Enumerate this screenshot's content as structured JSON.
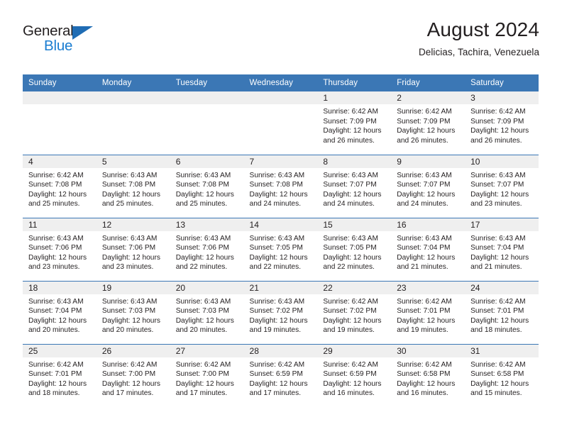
{
  "brand": {
    "name_part1": "General",
    "name_part2": "Blue",
    "triangle_color": "#1f6cb4",
    "blue_color": "#1a7dd1"
  },
  "header": {
    "month_title": "August 2024",
    "location": "Delicias, Tachira, Venezuela"
  },
  "theme": {
    "header_blue": "#3b77b5",
    "daynum_band": "#efefef",
    "text": "#231f20"
  },
  "weekday_headers": [
    "Sunday",
    "Monday",
    "Tuesday",
    "Wednesday",
    "Thursday",
    "Friday",
    "Saturday"
  ],
  "labels": {
    "sunrise_prefix": "Sunrise: ",
    "sunset_prefix": "Sunset: ",
    "daylight_prefix": "Daylight: "
  },
  "weeks": [
    [
      {
        "day": "",
        "empty": true
      },
      {
        "day": "",
        "empty": true
      },
      {
        "day": "",
        "empty": true
      },
      {
        "day": "",
        "empty": true
      },
      {
        "day": "1",
        "sunrise": "Sunrise: 6:42 AM",
        "sunset": "Sunset: 7:09 PM",
        "daylight": "Daylight: 12 hours and 26 minutes."
      },
      {
        "day": "2",
        "sunrise": "Sunrise: 6:42 AM",
        "sunset": "Sunset: 7:09 PM",
        "daylight": "Daylight: 12 hours and 26 minutes."
      },
      {
        "day": "3",
        "sunrise": "Sunrise: 6:42 AM",
        "sunset": "Sunset: 7:09 PM",
        "daylight": "Daylight: 12 hours and 26 minutes."
      }
    ],
    [
      {
        "day": "4",
        "sunrise": "Sunrise: 6:42 AM",
        "sunset": "Sunset: 7:08 PM",
        "daylight": "Daylight: 12 hours and 25 minutes."
      },
      {
        "day": "5",
        "sunrise": "Sunrise: 6:43 AM",
        "sunset": "Sunset: 7:08 PM",
        "daylight": "Daylight: 12 hours and 25 minutes."
      },
      {
        "day": "6",
        "sunrise": "Sunrise: 6:43 AM",
        "sunset": "Sunset: 7:08 PM",
        "daylight": "Daylight: 12 hours and 25 minutes."
      },
      {
        "day": "7",
        "sunrise": "Sunrise: 6:43 AM",
        "sunset": "Sunset: 7:08 PM",
        "daylight": "Daylight: 12 hours and 24 minutes."
      },
      {
        "day": "8",
        "sunrise": "Sunrise: 6:43 AM",
        "sunset": "Sunset: 7:07 PM",
        "daylight": "Daylight: 12 hours and 24 minutes."
      },
      {
        "day": "9",
        "sunrise": "Sunrise: 6:43 AM",
        "sunset": "Sunset: 7:07 PM",
        "daylight": "Daylight: 12 hours and 24 minutes."
      },
      {
        "day": "10",
        "sunrise": "Sunrise: 6:43 AM",
        "sunset": "Sunset: 7:07 PM",
        "daylight": "Daylight: 12 hours and 23 minutes."
      }
    ],
    [
      {
        "day": "11",
        "sunrise": "Sunrise: 6:43 AM",
        "sunset": "Sunset: 7:06 PM",
        "daylight": "Daylight: 12 hours and 23 minutes."
      },
      {
        "day": "12",
        "sunrise": "Sunrise: 6:43 AM",
        "sunset": "Sunset: 7:06 PM",
        "daylight": "Daylight: 12 hours and 23 minutes."
      },
      {
        "day": "13",
        "sunrise": "Sunrise: 6:43 AM",
        "sunset": "Sunset: 7:06 PM",
        "daylight": "Daylight: 12 hours and 22 minutes."
      },
      {
        "day": "14",
        "sunrise": "Sunrise: 6:43 AM",
        "sunset": "Sunset: 7:05 PM",
        "daylight": "Daylight: 12 hours and 22 minutes."
      },
      {
        "day": "15",
        "sunrise": "Sunrise: 6:43 AM",
        "sunset": "Sunset: 7:05 PM",
        "daylight": "Daylight: 12 hours and 22 minutes."
      },
      {
        "day": "16",
        "sunrise": "Sunrise: 6:43 AM",
        "sunset": "Sunset: 7:04 PM",
        "daylight": "Daylight: 12 hours and 21 minutes."
      },
      {
        "day": "17",
        "sunrise": "Sunrise: 6:43 AM",
        "sunset": "Sunset: 7:04 PM",
        "daylight": "Daylight: 12 hours and 21 minutes."
      }
    ],
    [
      {
        "day": "18",
        "sunrise": "Sunrise: 6:43 AM",
        "sunset": "Sunset: 7:04 PM",
        "daylight": "Daylight: 12 hours and 20 minutes."
      },
      {
        "day": "19",
        "sunrise": "Sunrise: 6:43 AM",
        "sunset": "Sunset: 7:03 PM",
        "daylight": "Daylight: 12 hours and 20 minutes."
      },
      {
        "day": "20",
        "sunrise": "Sunrise: 6:43 AM",
        "sunset": "Sunset: 7:03 PM",
        "daylight": "Daylight: 12 hours and 20 minutes."
      },
      {
        "day": "21",
        "sunrise": "Sunrise: 6:43 AM",
        "sunset": "Sunset: 7:02 PM",
        "daylight": "Daylight: 12 hours and 19 minutes."
      },
      {
        "day": "22",
        "sunrise": "Sunrise: 6:42 AM",
        "sunset": "Sunset: 7:02 PM",
        "daylight": "Daylight: 12 hours and 19 minutes."
      },
      {
        "day": "23",
        "sunrise": "Sunrise: 6:42 AM",
        "sunset": "Sunset: 7:01 PM",
        "daylight": "Daylight: 12 hours and 19 minutes."
      },
      {
        "day": "24",
        "sunrise": "Sunrise: 6:42 AM",
        "sunset": "Sunset: 7:01 PM",
        "daylight": "Daylight: 12 hours and 18 minutes."
      }
    ],
    [
      {
        "day": "25",
        "sunrise": "Sunrise: 6:42 AM",
        "sunset": "Sunset: 7:01 PM",
        "daylight": "Daylight: 12 hours and 18 minutes."
      },
      {
        "day": "26",
        "sunrise": "Sunrise: 6:42 AM",
        "sunset": "Sunset: 7:00 PM",
        "daylight": "Daylight: 12 hours and 17 minutes."
      },
      {
        "day": "27",
        "sunrise": "Sunrise: 6:42 AM",
        "sunset": "Sunset: 7:00 PM",
        "daylight": "Daylight: 12 hours and 17 minutes."
      },
      {
        "day": "28",
        "sunrise": "Sunrise: 6:42 AM",
        "sunset": "Sunset: 6:59 PM",
        "daylight": "Daylight: 12 hours and 17 minutes."
      },
      {
        "day": "29",
        "sunrise": "Sunrise: 6:42 AM",
        "sunset": "Sunset: 6:59 PM",
        "daylight": "Daylight: 12 hours and 16 minutes."
      },
      {
        "day": "30",
        "sunrise": "Sunrise: 6:42 AM",
        "sunset": "Sunset: 6:58 PM",
        "daylight": "Daylight: 12 hours and 16 minutes."
      },
      {
        "day": "31",
        "sunrise": "Sunrise: 6:42 AM",
        "sunset": "Sunset: 6:58 PM",
        "daylight": "Daylight: 12 hours and 15 minutes."
      }
    ]
  ]
}
